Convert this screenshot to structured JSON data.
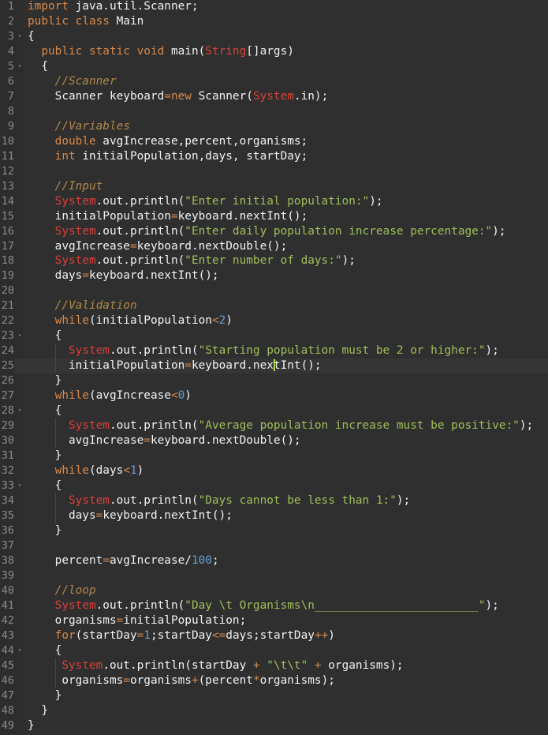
{
  "editor": {
    "language": "java",
    "active_line": 25,
    "cursor": {
      "line": 25,
      "column": 25
    },
    "colors": {
      "background": "#2f2f2f",
      "gutter": "#2d2d2d",
      "active_line": "#353535",
      "keyword": "#d98a4a",
      "type": "#d9403a",
      "string": "#9fbf5a",
      "number": "#6a9fd0",
      "comment": "#b0884a",
      "plain": "#f2f2f2",
      "line_number": "#8a8a8a",
      "cursor": "#a6e22e"
    },
    "fold_markers": [
      3,
      5,
      23,
      28,
      33,
      44
    ],
    "lines": [
      {
        "n": "1",
        "tokens": [
          [
            "kw",
            "import"
          ],
          [
            "plain",
            " java.util.Scanner;"
          ]
        ]
      },
      {
        "n": "2",
        "tokens": [
          [
            "kw",
            "public"
          ],
          [
            "plain",
            " "
          ],
          [
            "kw",
            "class"
          ],
          [
            "plain",
            " Main"
          ]
        ]
      },
      {
        "n": "3",
        "tokens": [
          [
            "plain",
            "{"
          ]
        ]
      },
      {
        "n": "4",
        "tokens": [
          [
            "plain",
            "  "
          ],
          [
            "kw",
            "public"
          ],
          [
            "plain",
            " "
          ],
          [
            "kw",
            "static"
          ],
          [
            "plain",
            " "
          ],
          [
            "kw",
            "void"
          ],
          [
            "plain",
            " main("
          ],
          [
            "type",
            "String"
          ],
          [
            "plain",
            "[]args)"
          ]
        ]
      },
      {
        "n": "5",
        "tokens": [
          [
            "plain",
            "  {"
          ]
        ]
      },
      {
        "n": "6",
        "tokens": [
          [
            "plain",
            "    "
          ],
          [
            "com",
            "//Scanner"
          ]
        ]
      },
      {
        "n": "7",
        "tokens": [
          [
            "plain",
            "    Scanner keyboard"
          ],
          [
            "op",
            "="
          ],
          [
            "kw",
            "new"
          ],
          [
            "plain",
            " Scanner("
          ],
          [
            "type",
            "System"
          ],
          [
            "plain",
            ".in);"
          ]
        ]
      },
      {
        "n": "8",
        "tokens": []
      },
      {
        "n": "9",
        "tokens": [
          [
            "plain",
            "    "
          ],
          [
            "com",
            "//Variables"
          ]
        ]
      },
      {
        "n": "10",
        "tokens": [
          [
            "plain",
            "    "
          ],
          [
            "kw",
            "double"
          ],
          [
            "plain",
            " avgIncrease,percent,organisms;"
          ]
        ]
      },
      {
        "n": "11",
        "tokens": [
          [
            "plain",
            "    "
          ],
          [
            "kw",
            "int"
          ],
          [
            "plain",
            " initialPopulation,days, startDay;"
          ]
        ]
      },
      {
        "n": "12",
        "tokens": []
      },
      {
        "n": "13",
        "tokens": [
          [
            "plain",
            "    "
          ],
          [
            "com",
            "//Input"
          ]
        ]
      },
      {
        "n": "14",
        "tokens": [
          [
            "plain",
            "    "
          ],
          [
            "type",
            "System"
          ],
          [
            "plain",
            ".out.println("
          ],
          [
            "str",
            "\"Enter initial population:\""
          ],
          [
            "plain",
            ");"
          ]
        ]
      },
      {
        "n": "15",
        "tokens": [
          [
            "plain",
            "    initialPopulation"
          ],
          [
            "op",
            "="
          ],
          [
            "plain",
            "keyboard.nextInt();"
          ]
        ]
      },
      {
        "n": "16",
        "tokens": [
          [
            "plain",
            "    "
          ],
          [
            "type",
            "System"
          ],
          [
            "plain",
            ".out.println("
          ],
          [
            "str",
            "\"Enter daily population increase percentage:\""
          ],
          [
            "plain",
            ");"
          ]
        ]
      },
      {
        "n": "17",
        "tokens": [
          [
            "plain",
            "    avgIncrease"
          ],
          [
            "op",
            "="
          ],
          [
            "plain",
            "keyboard.nextDouble();"
          ]
        ]
      },
      {
        "n": "18",
        "tokens": [
          [
            "plain",
            "    "
          ],
          [
            "type",
            "System"
          ],
          [
            "plain",
            ".out.println("
          ],
          [
            "str",
            "\"Enter number of days:\""
          ],
          [
            "plain",
            ");"
          ]
        ]
      },
      {
        "n": "19",
        "tokens": [
          [
            "plain",
            "    days"
          ],
          [
            "op",
            "="
          ],
          [
            "plain",
            "keyboard.nextInt();"
          ]
        ]
      },
      {
        "n": "20",
        "tokens": []
      },
      {
        "n": "21",
        "tokens": [
          [
            "plain",
            "    "
          ],
          [
            "com",
            "//Validation"
          ]
        ]
      },
      {
        "n": "22",
        "tokens": [
          [
            "plain",
            "    "
          ],
          [
            "kw",
            "while"
          ],
          [
            "plain",
            "(initialPopulation"
          ],
          [
            "op",
            "<"
          ],
          [
            "num",
            "2"
          ],
          [
            "plain",
            ")"
          ]
        ]
      },
      {
        "n": "23",
        "tokens": [
          [
            "plain",
            "    {"
          ]
        ]
      },
      {
        "n": "24",
        "tokens": [
          [
            "plain",
            "      "
          ],
          [
            "type",
            "System"
          ],
          [
            "plain",
            ".out.println("
          ],
          [
            "str",
            "\"Starting population must be 2 or higher:\""
          ],
          [
            "plain",
            ");"
          ]
        ]
      },
      {
        "n": "25",
        "tokens": [
          [
            "plain",
            "      initialPopulation"
          ],
          [
            "op",
            "="
          ],
          [
            "plain",
            "keyboard.nex"
          ],
          [
            "cursor",
            ""
          ],
          [
            "plain",
            "tInt();"
          ]
        ]
      },
      {
        "n": "26",
        "tokens": [
          [
            "plain",
            "    }"
          ]
        ]
      },
      {
        "n": "27",
        "tokens": [
          [
            "plain",
            "    "
          ],
          [
            "kw",
            "while"
          ],
          [
            "plain",
            "(avgIncrease"
          ],
          [
            "op",
            "<"
          ],
          [
            "num",
            "0"
          ],
          [
            "plain",
            ")"
          ]
        ]
      },
      {
        "n": "28",
        "tokens": [
          [
            "plain",
            "    {"
          ]
        ]
      },
      {
        "n": "29",
        "tokens": [
          [
            "plain",
            "      "
          ],
          [
            "type",
            "System"
          ],
          [
            "plain",
            ".out.println("
          ],
          [
            "str",
            "\"Average population increase must be positive:\""
          ],
          [
            "plain",
            ");"
          ]
        ]
      },
      {
        "n": "30",
        "tokens": [
          [
            "plain",
            "      avgIncrease"
          ],
          [
            "op",
            "="
          ],
          [
            "plain",
            "keyboard.nextDouble();"
          ]
        ]
      },
      {
        "n": "31",
        "tokens": [
          [
            "plain",
            "    }"
          ]
        ]
      },
      {
        "n": "32",
        "tokens": [
          [
            "plain",
            "    "
          ],
          [
            "kw",
            "while"
          ],
          [
            "plain",
            "(days"
          ],
          [
            "op",
            "<"
          ],
          [
            "num",
            "1"
          ],
          [
            "plain",
            ")"
          ]
        ]
      },
      {
        "n": "33",
        "tokens": [
          [
            "plain",
            "    {"
          ]
        ]
      },
      {
        "n": "34",
        "tokens": [
          [
            "plain",
            "      "
          ],
          [
            "type",
            "System"
          ],
          [
            "plain",
            ".out.println("
          ],
          [
            "str",
            "\"Days cannot be less than 1:\""
          ],
          [
            "plain",
            ");"
          ]
        ]
      },
      {
        "n": "35",
        "tokens": [
          [
            "plain",
            "      days"
          ],
          [
            "op",
            "="
          ],
          [
            "plain",
            "keyboard.nextInt();"
          ]
        ]
      },
      {
        "n": "36",
        "tokens": [
          [
            "plain",
            "    }"
          ]
        ]
      },
      {
        "n": "37",
        "tokens": []
      },
      {
        "n": "38",
        "tokens": [
          [
            "plain",
            "    percent"
          ],
          [
            "op",
            "="
          ],
          [
            "plain",
            "avgIncrease/"
          ],
          [
            "num",
            "100"
          ],
          [
            "plain",
            ";"
          ]
        ]
      },
      {
        "n": "39",
        "tokens": []
      },
      {
        "n": "40",
        "tokens": [
          [
            "plain",
            "    "
          ],
          [
            "com",
            "//loop"
          ]
        ]
      },
      {
        "n": "41",
        "tokens": [
          [
            "plain",
            "    "
          ],
          [
            "type",
            "System"
          ],
          [
            "plain",
            ".out.println("
          ],
          [
            "str",
            "\"Day \\t Organisms\\n________________________\""
          ],
          [
            "plain",
            ");"
          ]
        ]
      },
      {
        "n": "42",
        "tokens": [
          [
            "plain",
            "    organisms"
          ],
          [
            "op",
            "="
          ],
          [
            "plain",
            "initialPopulation;"
          ]
        ]
      },
      {
        "n": "43",
        "tokens": [
          [
            "plain",
            "    "
          ],
          [
            "kw",
            "for"
          ],
          [
            "plain",
            "(startDay"
          ],
          [
            "op",
            "="
          ],
          [
            "num",
            "1"
          ],
          [
            "plain",
            ";startDay"
          ],
          [
            "op",
            "<="
          ],
          [
            "plain",
            "days;startDay"
          ],
          [
            "op",
            "++"
          ],
          [
            "plain",
            ")"
          ]
        ]
      },
      {
        "n": "44",
        "tokens": [
          [
            "plain",
            "    {"
          ]
        ]
      },
      {
        "n": "45",
        "tokens": [
          [
            "plain",
            "     "
          ],
          [
            "type",
            "System"
          ],
          [
            "plain",
            ".out.println(startDay "
          ],
          [
            "op",
            "+"
          ],
          [
            "plain",
            " "
          ],
          [
            "str",
            "\"\\t\\t\""
          ],
          [
            "plain",
            " "
          ],
          [
            "op",
            "+"
          ],
          [
            "plain",
            " organisms);"
          ]
        ]
      },
      {
        "n": "46",
        "tokens": [
          [
            "plain",
            "     organisms"
          ],
          [
            "op",
            "="
          ],
          [
            "plain",
            "organisms"
          ],
          [
            "op",
            "+"
          ],
          [
            "plain",
            "(percent"
          ],
          [
            "op",
            "*"
          ],
          [
            "plain",
            "organisms);"
          ]
        ]
      },
      {
        "n": "47",
        "tokens": [
          [
            "plain",
            "    }"
          ]
        ]
      },
      {
        "n": "48",
        "tokens": [
          [
            "plain",
            "  }"
          ]
        ]
      },
      {
        "n": "49",
        "tokens": [
          [
            "plain",
            "}"
          ]
        ]
      }
    ]
  }
}
